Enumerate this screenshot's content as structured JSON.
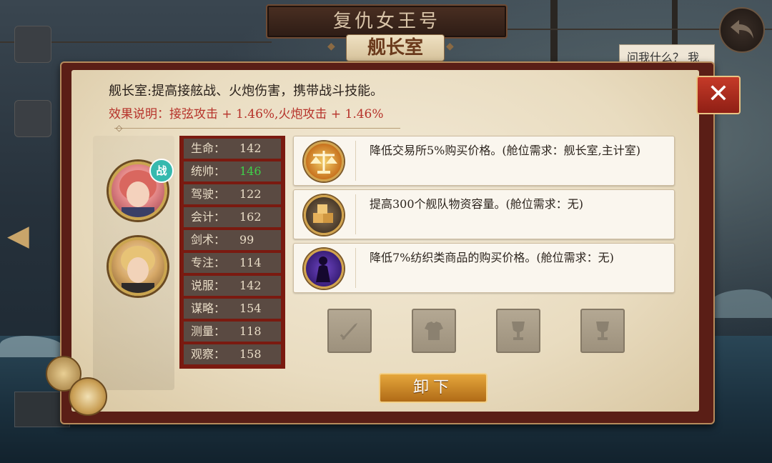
{
  "header": {
    "ship_name": "复仇女王号",
    "cabin_title": "舰长室",
    "ask_hint": "问我什么？ 我"
  },
  "cabin": {
    "description": "舰长室:提高接舷战、火炮伤害，携带战斗技能。",
    "effect": "效果说明：接弦攻击 + 1.46%,火炮攻击 + 1.46%"
  },
  "officer": {
    "badge": "战",
    "stats": [
      {
        "label": "生命：",
        "value": "142"
      },
      {
        "label": "统帅：",
        "value": "146",
        "highlight": "#3fd14a"
      },
      {
        "label": "驾驶：",
        "value": "122"
      },
      {
        "label": "会计：",
        "value": "162"
      },
      {
        "label": "剑术：",
        "value": "99"
      },
      {
        "label": "专注：",
        "value": "114"
      },
      {
        "label": "说服：",
        "value": "142"
      },
      {
        "label": "谋略：",
        "value": "154"
      },
      {
        "label": "测量：",
        "value": "118"
      },
      {
        "label": "观察：",
        "value": "158"
      }
    ]
  },
  "bonuses": [
    {
      "icon": "scales-icon",
      "text": "降低交易所5%购买价格。(舱位需求：舰长室,主计室)"
    },
    {
      "icon": "cargo-crate-icon",
      "text": "提高300个舰队物资容量。(舱位需求：无)"
    },
    {
      "icon": "dancer-silhouette-icon",
      "text": "降低7%纺织类商品的购买价格。(舱位需求：无)"
    }
  ],
  "equipment_slots": [
    "sword-slot-icon",
    "armor-slot-icon",
    "trophy-slot-icon",
    "trophy-slot-icon"
  ],
  "actions": {
    "unload": "卸下"
  },
  "colors": {
    "effect_text": "#b6322a",
    "stat_highlight": "#3fd14a",
    "frame": "#5a1e16",
    "button": "#d08a29"
  }
}
